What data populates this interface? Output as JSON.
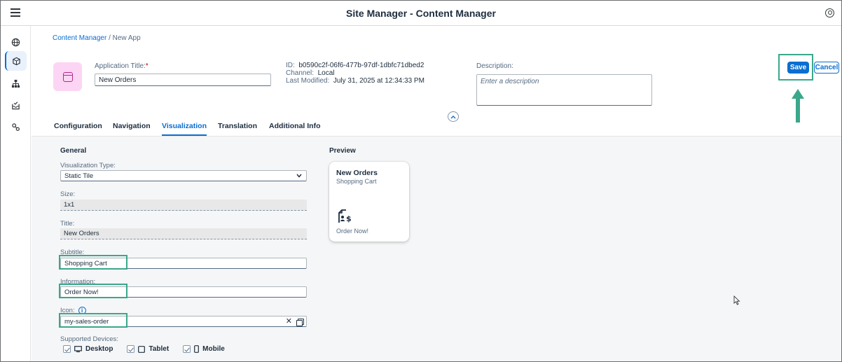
{
  "shell": {
    "title": "Site Manager - Content Manager"
  },
  "breadcrumb": {
    "link": "Content Manager",
    "separator": "/",
    "current": "New App"
  },
  "header": {
    "app_title_label": "Application Title:",
    "required_mark": "*",
    "app_title_value": "New Orders",
    "id_label": "ID:",
    "id_value": "b0590c2f-06f6-477b-97df-1dbfc71dbed2",
    "channel_label": "Channel:",
    "channel_value": "Local",
    "modified_label": "Last Modified:",
    "modified_value": "July 31, 2025 at 12:34:33 PM",
    "description_label": "Description:",
    "description_placeholder": "Enter a description",
    "save_label": "Save",
    "cancel_label": "Cancel"
  },
  "tabs": [
    "Configuration",
    "Navigation",
    "Visualization",
    "Translation",
    "Additional Info"
  ],
  "active_tab": "Visualization",
  "form": {
    "section_title": "General",
    "viz_type_label": "Visualization Type:",
    "viz_type_value": "Static Tile",
    "size_label": "Size:",
    "size_value": "1x1",
    "title_label": "Title:",
    "title_value": "New Orders",
    "subtitle_label": "Subtitle:",
    "subtitle_value": "Shopping Cart",
    "information_label": "Information:",
    "information_value": "Order Now!",
    "icon_label": "Icon:",
    "icon_value": "my-sales-order",
    "devices_label": "Supported Devices:",
    "devices": [
      "Desktop",
      "Tablet",
      "Mobile"
    ]
  },
  "preview": {
    "section_title": "Preview",
    "tile_title": "New Orders",
    "tile_subtitle": "Shopping Cart",
    "tile_info": "Order Now!",
    "tile_icon": "sales-order-icon"
  },
  "colors": {
    "accent": "#0a6ed1",
    "highlight": "#3aa88a",
    "app_icon_bg": "#fcd5f4"
  }
}
